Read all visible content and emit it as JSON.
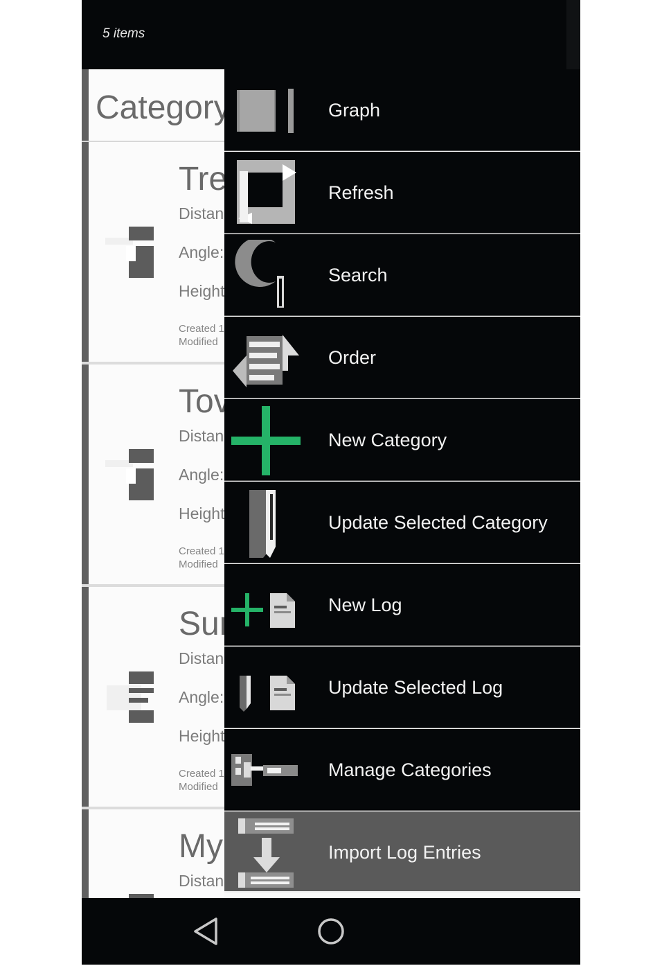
{
  "topbar": {
    "item_count": "5 items"
  },
  "list": {
    "header": "Category",
    "rows": [
      {
        "name": "Tre",
        "distance": "Distan",
        "angle": "Angle:",
        "height": "Height",
        "created": "Created 1",
        "modified": "Modified",
        "icon": "stand-icon"
      },
      {
        "name": "Tov",
        "distance": "Distan",
        "angle": "Angle:",
        "height": "Height",
        "created": "Created 1",
        "modified": "Modified",
        "icon": "stand-icon"
      },
      {
        "name": "Sur",
        "distance": "Distan",
        "angle": "Angle:",
        "height": "Height",
        "created": "Created 1",
        "modified": "Modified",
        "icon": "list-bars-icon"
      },
      {
        "name": "My",
        "distance": "Distan",
        "icon": "stand-icon"
      }
    ]
  },
  "menu": {
    "items": [
      {
        "label": "Graph",
        "icon": "graph-icon"
      },
      {
        "label": "Refresh",
        "icon": "refresh-icon"
      },
      {
        "label": "Search",
        "icon": "search-icon"
      },
      {
        "label": "Order",
        "icon": "order-icon"
      },
      {
        "label": "New Category",
        "icon": "plus-icon"
      },
      {
        "label": "Update Selected Category",
        "icon": "pencil-icon"
      },
      {
        "label": "New Log",
        "icon": "new-log-icon"
      },
      {
        "label": "Update Selected Log",
        "icon": "edit-log-icon"
      },
      {
        "label": "Manage Categories",
        "icon": "manage-icon"
      },
      {
        "label": "Import Log Entries",
        "icon": "import-icon",
        "selected": true
      }
    ]
  },
  "colors": {
    "accent_green": "#25b368",
    "drawer_bg": "#050709",
    "selected_bg": "#5a5a5a"
  },
  "navbar": {
    "back": "back-icon",
    "home": "home-icon"
  }
}
